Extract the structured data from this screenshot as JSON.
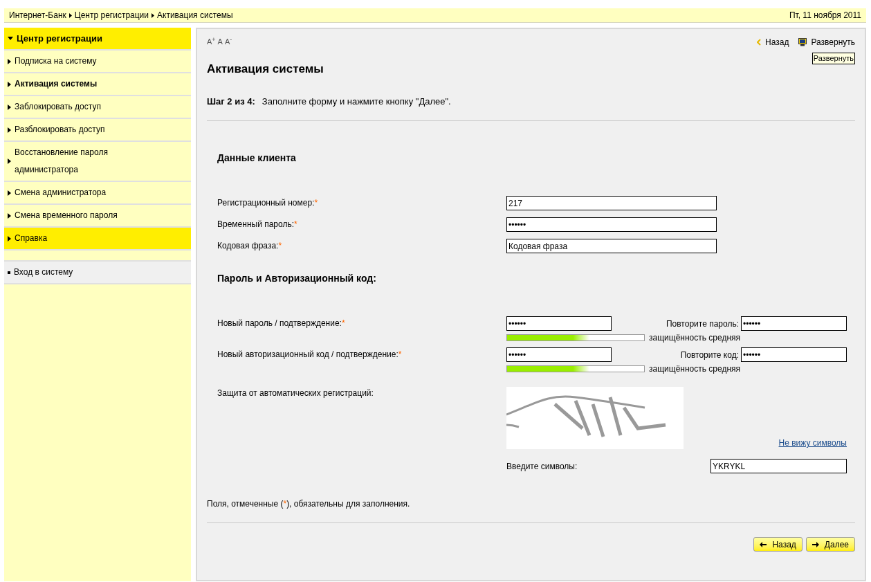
{
  "breadcrumbs": [
    "Интернет-Банк",
    "Центр регистрации",
    "Активация системы"
  ],
  "date": "Пт, 11 ноября 2011",
  "sidebar": {
    "items": [
      {
        "kind": "header",
        "label": "Центр регистрации",
        "highlighted": true,
        "current": false
      },
      {
        "kind": "item",
        "label": "Подписка на систему",
        "highlighted": false,
        "current": false
      },
      {
        "kind": "item",
        "label": "Активация системы",
        "highlighted": false,
        "current": true
      },
      {
        "kind": "item",
        "label": "Заблокировать доступ",
        "highlighted": false,
        "current": false
      },
      {
        "kind": "item",
        "label": "Разблокировать доступ",
        "highlighted": false,
        "current": false
      },
      {
        "kind": "item",
        "label": "Восстановление пароля администратора",
        "highlighted": false,
        "current": false
      },
      {
        "kind": "item",
        "label": "Смена администратора",
        "highlighted": false,
        "current": false
      },
      {
        "kind": "item",
        "label": "Смена временного пароля",
        "highlighted": false,
        "current": false
      },
      {
        "kind": "item",
        "label": "Справка",
        "highlighted": true,
        "current": false
      },
      {
        "kind": "spacer"
      },
      {
        "kind": "link",
        "label": "Вход в систему",
        "highlighted": false,
        "current": false
      }
    ]
  },
  "font_size_controls": [
    {
      "letter": "A",
      "sign": "+"
    },
    {
      "letter": "A"
    },
    {
      "letter": "A",
      "sign": "-"
    }
  ],
  "top_links": [
    {
      "kind": "back",
      "label": "Назад"
    },
    {
      "kind": "expand",
      "label": "Развернуть"
    }
  ],
  "tooltip": "Развернуть",
  "title": "Активация системы",
  "step": {
    "label": "Шаг 2 из 4:",
    "text": "Заполните форму и нажмите кнопку \"Далее\"."
  },
  "sections": [
    {
      "title": "Данные клиента",
      "rows": [
        {
          "kind": "single",
          "label": "Регистрационный номер:",
          "mark": "*",
          "value": "217"
        },
        {
          "kind": "single",
          "label": "Временный пароль:",
          "mark": "*",
          "value": "••••••"
        },
        {
          "kind": "single",
          "label": "Кодовая фраза:",
          "mark": "*",
          "value": "Кодовая фраза"
        }
      ]
    },
    {
      "title": "Пароль и Авторизационный код:",
      "rows": [
        {
          "kind": "pair",
          "label": "Новый пароль / подтверждение:",
          "mark": "*",
          "value": "••••••",
          "repeat_label": "Повторите пароль:",
          "repeat_value": "••••••",
          "strength": {
            "level": 0.6,
            "reading": "защищённость средняя"
          }
        },
        {
          "kind": "pair",
          "label": "Новый авторизационный код / подтверждение:",
          "mark": "*",
          "value": "••••••",
          "repeat_label": "Повторите код:",
          "repeat_value": "••••••",
          "strength": {
            "level": 0.6,
            "reading": "защищённость средняя"
          }
        }
      ]
    }
  ],
  "captcha": {
    "label": "Защита от автоматических регистраций:",
    "refresh_link": "Не вижу символы",
    "input_label": "Введите символы:",
    "value": "YKRYKL"
  },
  "note": {
    "before": "Поля, отмеченные (",
    "mark": "*",
    "after": "), обязательны для заполнения."
  },
  "buttons": [
    {
      "kind": "back",
      "label": "Назад"
    },
    {
      "kind": "next",
      "label": "Далее"
    }
  ]
}
